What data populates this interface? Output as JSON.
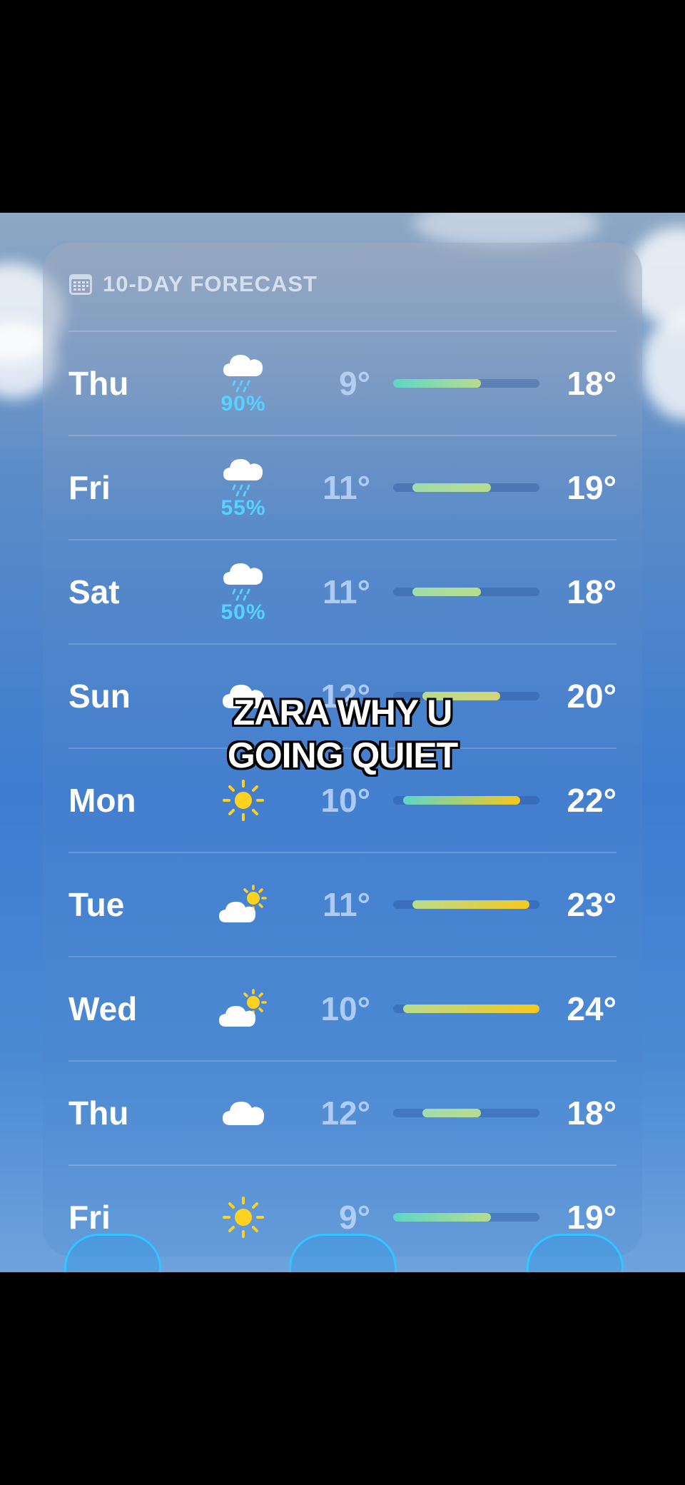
{
  "forecast": {
    "title": "10-DAY FORECAST",
    "icon": "calendar-icon",
    "range_min": 9,
    "range_max": 24,
    "days": [
      {
        "day": "Thu",
        "icon": "rain-cloud-icon",
        "precip": "90%",
        "low": "9°",
        "high": "18°",
        "low_val": 9,
        "high_val": 18
      },
      {
        "day": "Fri",
        "icon": "rain-cloud-icon",
        "precip": "55%",
        "low": "11°",
        "high": "19°",
        "low_val": 11,
        "high_val": 19
      },
      {
        "day": "Sat",
        "icon": "rain-cloud-icon",
        "precip": "50%",
        "low": "11°",
        "high": "18°",
        "low_val": 11,
        "high_val": 18
      },
      {
        "day": "Sun",
        "icon": "cloud-icon",
        "precip": "",
        "low": "12°",
        "high": "20°",
        "low_val": 12,
        "high_val": 20
      },
      {
        "day": "Mon",
        "icon": "sun-icon",
        "precip": "",
        "low": "10°",
        "high": "22°",
        "low_val": 10,
        "high_val": 22
      },
      {
        "day": "Tue",
        "icon": "partly-sunny-icon",
        "precip": "",
        "low": "11°",
        "high": "23°",
        "low_val": 11,
        "high_val": 23
      },
      {
        "day": "Wed",
        "icon": "partly-sunny-icon",
        "precip": "",
        "low": "10°",
        "high": "24°",
        "low_val": 10,
        "high_val": 24
      },
      {
        "day": "Thu",
        "icon": "cloud-icon",
        "precip": "",
        "low": "12°",
        "high": "18°",
        "low_val": 12,
        "high_val": 18
      },
      {
        "day": "Fri",
        "icon": "sun-icon",
        "precip": "",
        "low": "9°",
        "high": "19°",
        "low_val": 9,
        "high_val": 19
      }
    ]
  },
  "caption": {
    "line1": "ZARA WHY U",
    "line2": "GOING QUIET"
  },
  "colors": {
    "precip": "#55d2ff",
    "bar_cool": "#5ed6c8",
    "bar_mild": "#b8dc8c",
    "bar_warm": "#f6c81e"
  }
}
